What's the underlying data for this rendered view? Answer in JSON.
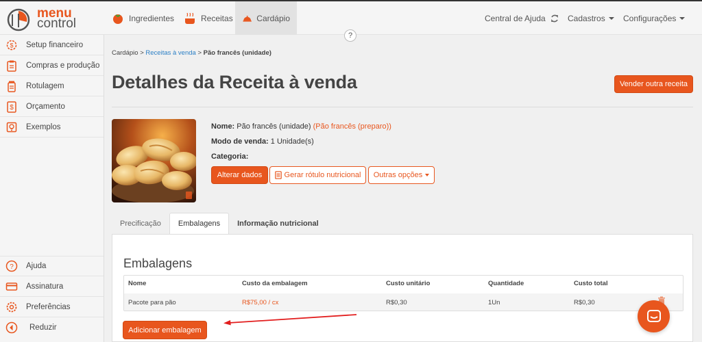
{
  "app": {
    "logo_line1": "menu",
    "logo_line2": "control"
  },
  "topnav": {
    "items": [
      {
        "label": "Ingredientes",
        "icon": "tomato-icon"
      },
      {
        "label": "Receitas",
        "icon": "pot-icon"
      },
      {
        "label": "Cardápio",
        "icon": "cloche-icon",
        "active": true
      }
    ],
    "help_center": "Central de Ajuda",
    "cadastros": "Cadastros",
    "configuracoes": "Configurações"
  },
  "sidebar": {
    "items": [
      {
        "label": "Setup financeiro",
        "icon": "gear-dollar-icon"
      },
      {
        "label": "Compras e produção",
        "icon": "clipboard-icon"
      },
      {
        "label": "Rotulagem",
        "icon": "jar-icon"
      },
      {
        "label": "Orçamento",
        "icon": "dollar-doc-icon"
      },
      {
        "label": "Exemplos",
        "icon": "lightbulb-icon"
      }
    ],
    "bottom_items": [
      {
        "label": "Ajuda",
        "icon": "question-icon"
      },
      {
        "label": "Assinatura",
        "icon": "credit-card-icon"
      },
      {
        "label": "Preferências",
        "icon": "gear-icon"
      },
      {
        "label": "Reduzir",
        "icon": "collapse-icon"
      }
    ]
  },
  "help_button": "?",
  "breadcrumb": {
    "root": "Cardápio",
    "sep": ">",
    "link": "Receitas à venda",
    "current": "Pão francês (unidade)"
  },
  "page": {
    "title": "Detalhes da Receita à venda",
    "sell_other": "Vender outra receita"
  },
  "details": {
    "name_label": "Nome:",
    "name_value": "Pão francês (unidade)",
    "name_link": "Pão francês (preparo)",
    "mode_label": "Modo de venda:",
    "mode_value": "1 Unidade(s)",
    "category_label": "Categoria:"
  },
  "actions": {
    "edit": "Alterar dados",
    "label": "Gerar rótulo nutricional",
    "more": "Outras opções"
  },
  "tabs": [
    "Precificação",
    "Embalagens",
    "Informação nutricional"
  ],
  "packaging": {
    "title": "Embalagens",
    "columns": [
      "Nome",
      "Custo da embalagem",
      "Custo unitário",
      "Quantidade",
      "Custo total"
    ],
    "rows": [
      [
        "Pacote para pão",
        "R$75,00 / cx",
        "R$0,30",
        "1Un",
        "R$0,30"
      ]
    ],
    "add_button": "Adicionar embalagem"
  },
  "colors": {
    "accent": "#e8561e",
    "link": "#2b7fc5"
  }
}
